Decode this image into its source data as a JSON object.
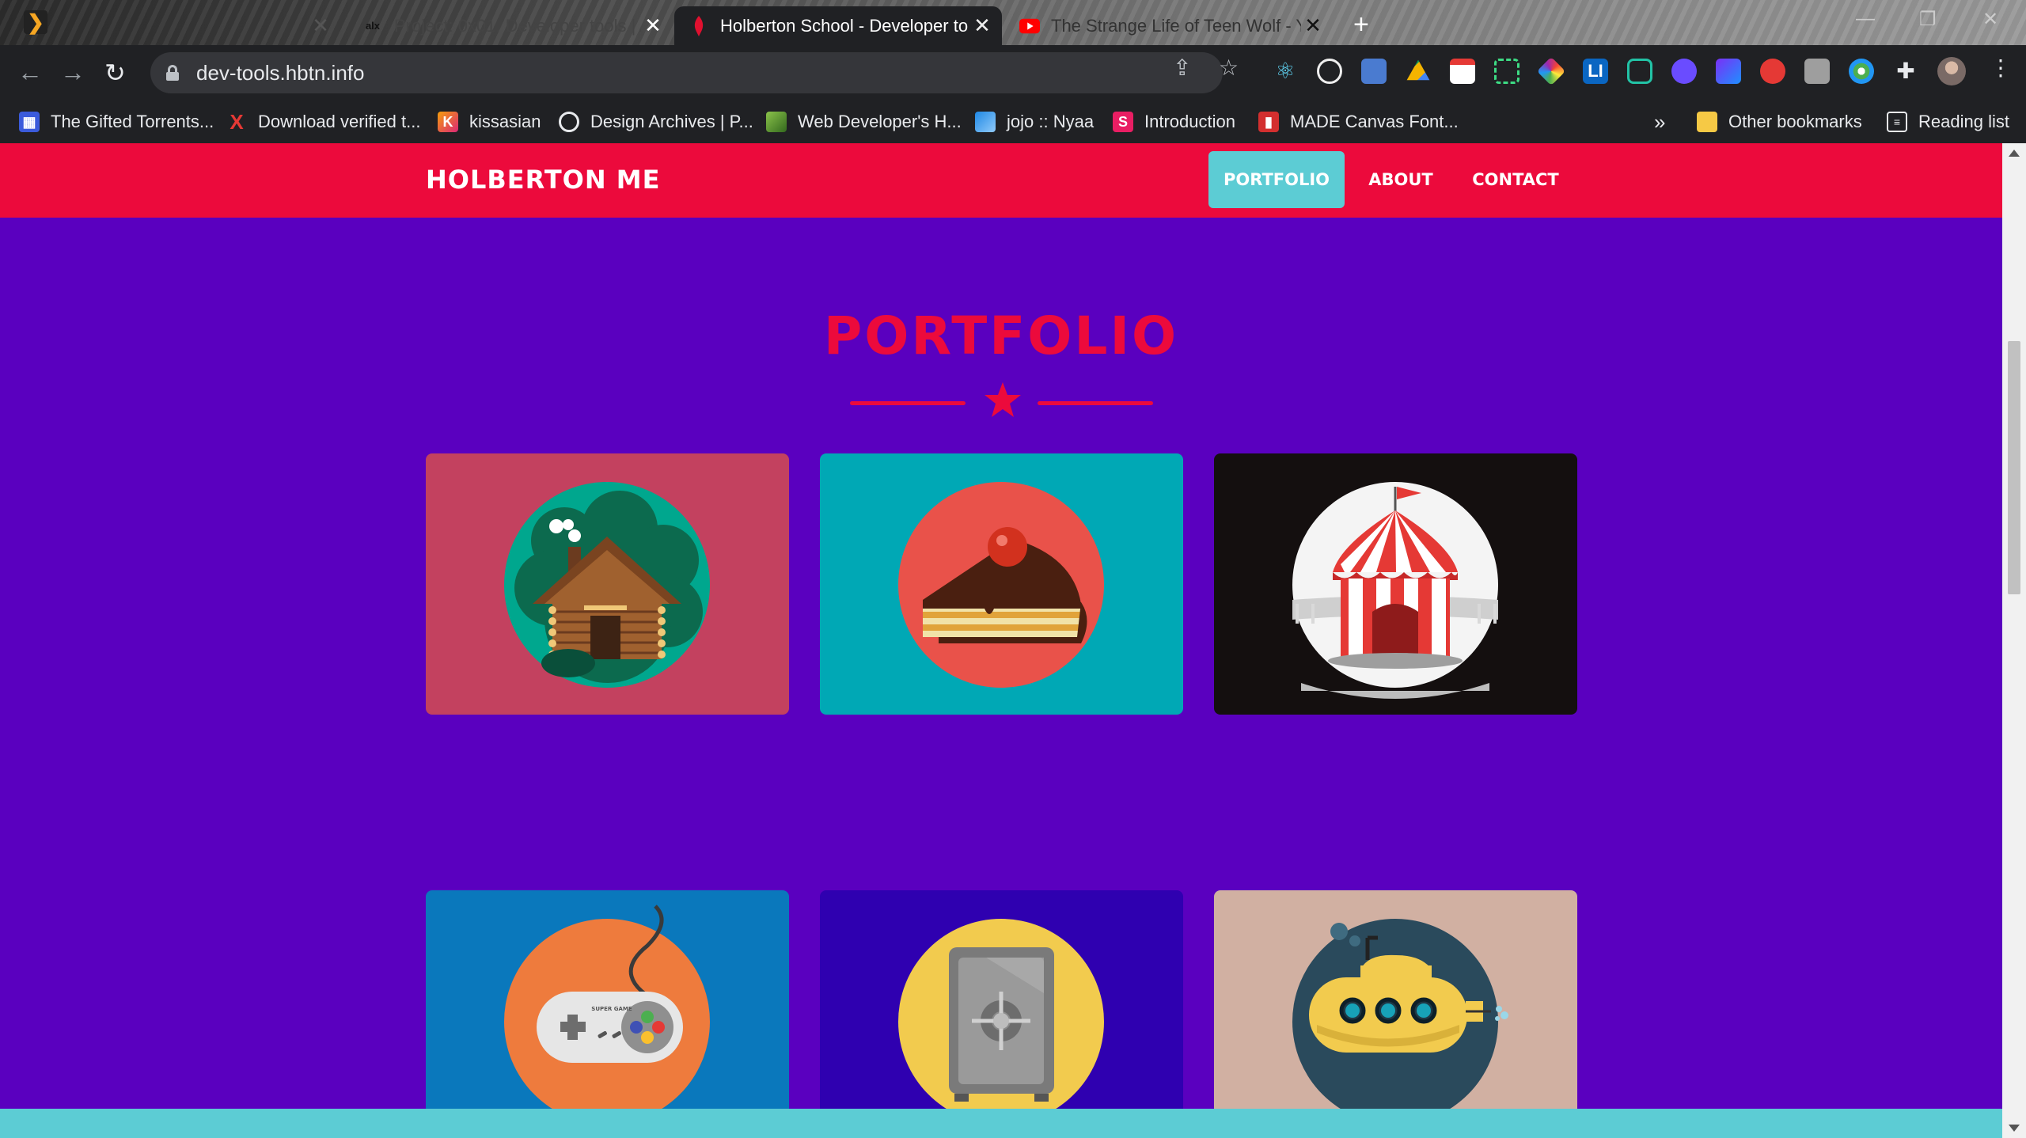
{
  "browser": {
    "tabs": [
      {
        "title": "",
        "favicon": "plex-icon"
      },
      {
        "title": "Project: 0x01. Developer tools | A",
        "favicon": "alx-icon"
      },
      {
        "title": "Holberton School - Developer to",
        "favicon": "holberton-icon",
        "active": true
      },
      {
        "title": "The Strange Life of Teen Wolf - Y",
        "favicon": "youtube-icon"
      }
    ],
    "url": "dev-tools.hbtn.info",
    "bookmarks": [
      {
        "label": "The Gifted Torrents...",
        "icon": "torrents-icon"
      },
      {
        "label": "Download verified t...",
        "icon": "x-icon"
      },
      {
        "label": "kissasian",
        "icon": "k-icon"
      },
      {
        "label": "Design Archives | P...",
        "icon": "globe-icon"
      },
      {
        "label": "Web Developer's H...",
        "icon": "web-dev-icon"
      },
      {
        "label": "jojo :: Nyaa",
        "icon": "nyaa-icon"
      },
      {
        "label": "Introduction",
        "icon": "s-icon"
      },
      {
        "label": "MADE Canvas Font...",
        "icon": "made-icon"
      }
    ],
    "overflow_label": "»",
    "other_bookmarks": "Other bookmarks",
    "reading_list": "Reading list"
  },
  "site": {
    "brand": "HOLBERTON ME",
    "nav": [
      {
        "label": "PORTFOLIO",
        "active": true
      },
      {
        "label": "ABOUT"
      },
      {
        "label": "CONTACT"
      }
    ],
    "section_title": "PORTFOLIO",
    "portfolio": [
      {
        "name": "cabin",
        "bg": "#c3415f"
      },
      {
        "name": "cake",
        "bg": "#00a8b5"
      },
      {
        "name": "circus",
        "bg": "#140f0f"
      },
      {
        "name": "game-controller",
        "bg": "#0a78bc"
      },
      {
        "name": "safe",
        "bg": "#2f00b0"
      },
      {
        "name": "submarine",
        "bg": "#d1b0a2"
      }
    ],
    "controller_text": "SUPER GAME"
  },
  "colors": {
    "accent": "#ec0a3c",
    "page_bg": "#5a00bf",
    "teal": "#5cccd4"
  }
}
